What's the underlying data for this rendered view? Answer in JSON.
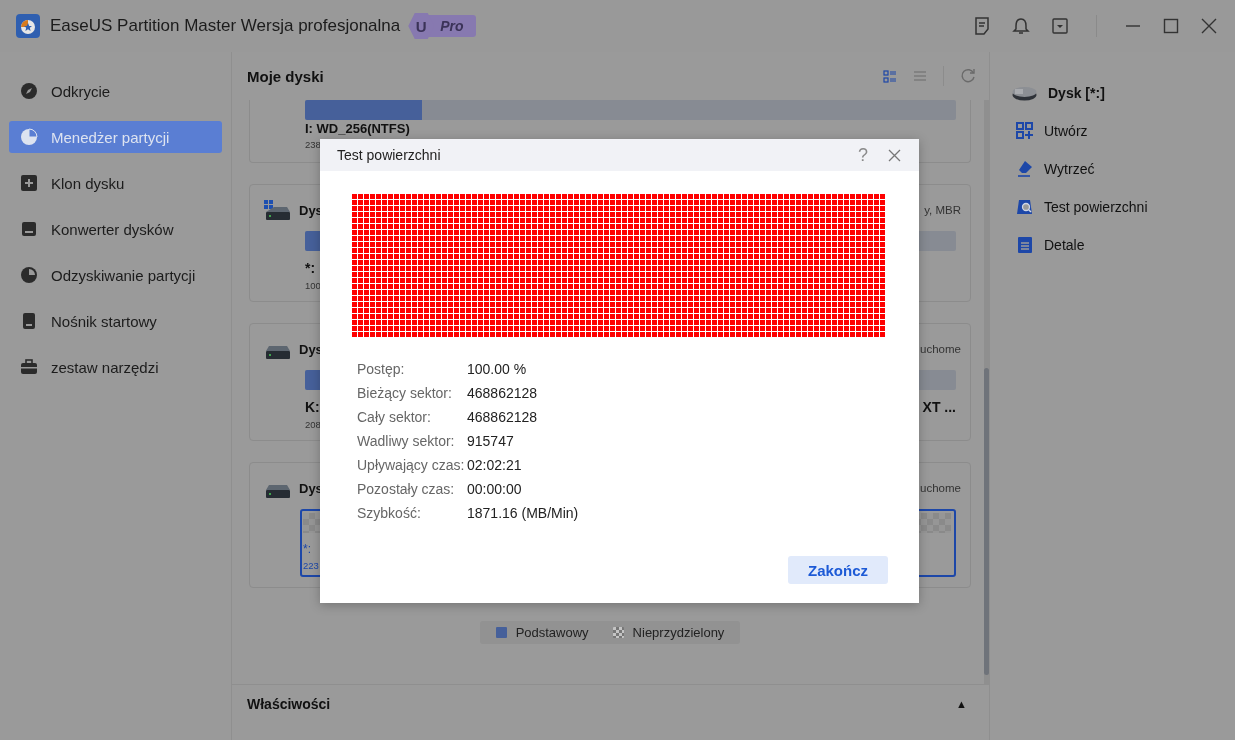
{
  "window": {
    "title": "EaseUS Partition Master Wersja profesjonalna",
    "badge_letter": "U",
    "badge": "Pro"
  },
  "sidebar": {
    "items": [
      {
        "label": "Odkrycie",
        "kind": "discover",
        "selected": false
      },
      {
        "label": "Menedżer partycji",
        "kind": "partition",
        "selected": true
      },
      {
        "label": "Klon dysku",
        "kind": "clone",
        "selected": false
      },
      {
        "label": "Konwerter dysków",
        "kind": "convert",
        "selected": false
      },
      {
        "label": "Odzyskiwanie partycji",
        "kind": "recovery",
        "selected": false
      },
      {
        "label": "Nośnik startowy",
        "kind": "media",
        "selected": false
      },
      {
        "label": "zestaw narzędzi",
        "kind": "toolkit",
        "selected": false
      }
    ]
  },
  "disks_panel": {
    "title": "Moje dyski",
    "view_modes": [
      {
        "kind": "grid",
        "selected": true
      },
      {
        "kind": "list",
        "selected": false
      }
    ],
    "disks": [
      {
        "kind": "scrolled",
        "partition": {
          "kind": "primary",
          "label": "I: WD_256(NTFS)",
          "size": "238",
          "level": 0.18,
          "selected": false
        }
      },
      {
        "kind": "system",
        "header": "Dys",
        "info": "y, MBR",
        "partition": {
          "kind": "primary",
          "label": "*:",
          "size": "100",
          "level": 0.3,
          "selected": false
        }
      },
      {
        "kind": "disk",
        "header": "Dys",
        "info": "uchome",
        "partition": {
          "kind": "primary",
          "label": "K:",
          "label_right": "XT ...",
          "size": "208",
          "level": 0.3,
          "selected": false
        }
      },
      {
        "kind": "disk",
        "header": "Dys",
        "info": "uchome",
        "partition": {
          "kind": "unallocated",
          "label": "*:",
          "size": "223",
          "selected": true
        }
      }
    ],
    "legend": [
      {
        "label": "Podstawowy",
        "kind": "primary"
      },
      {
        "label": "Nieprzydzielony",
        "kind": "unallocated"
      }
    ]
  },
  "properties": {
    "title": "Właściwości",
    "toggle": "▲"
  },
  "actions_panel": {
    "title": "Dysk [*:]",
    "actions": [
      {
        "label": "Utwórz",
        "kind": "create"
      },
      {
        "label": "Wytrzeć",
        "kind": "wipe"
      },
      {
        "label": "Test powierzchni",
        "kind": "surface"
      },
      {
        "label": "Detale",
        "kind": "details"
      }
    ]
  },
  "dialog": {
    "title": "Test powierzchni",
    "help": "?",
    "stats": [
      {
        "label": "Postęp:",
        "value": "100.00 %"
      },
      {
        "label": "Bieżący sektor:",
        "value": "468862128"
      },
      {
        "label": "Cały sektor:",
        "value": "468862128"
      },
      {
        "label": "Wadliwy sektor:",
        "value": "915747"
      },
      {
        "label": "Upływający czas:",
        "value": "02:02:21"
      },
      {
        "label": "Pozostały czas:",
        "value": "00:00:00"
      },
      {
        "label": "Szybkość:",
        "value": "1871.16 (MB/Min)"
      }
    ],
    "button": "Zakończ"
  }
}
